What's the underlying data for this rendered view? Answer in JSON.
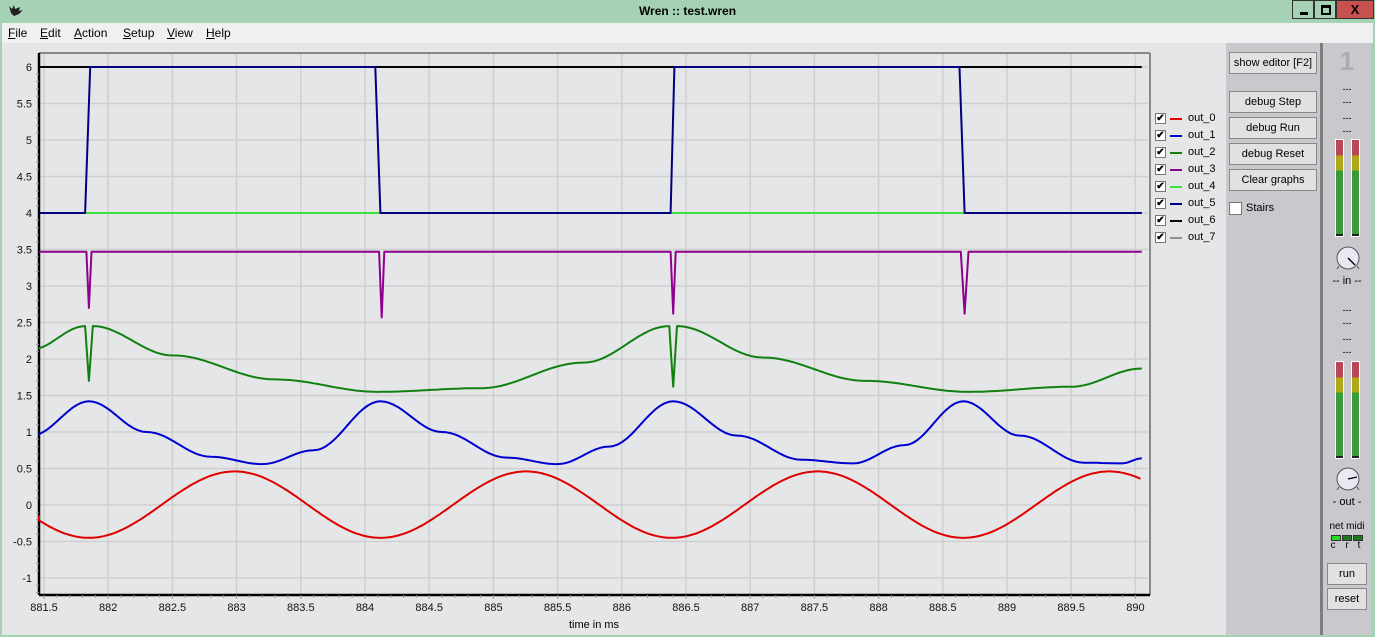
{
  "window": {
    "title": "Wren  ::  test.wren",
    "app_icon": "wren-bird-icon",
    "controls": {
      "minimize": "minimize-icon",
      "maximize": "maximize-icon",
      "close_label": "X"
    }
  },
  "menubar": {
    "items": [
      {
        "label": "File",
        "mnemonic": "F",
        "rest": "ile"
      },
      {
        "label": "Edit",
        "mnemonic": "E",
        "rest": "dit"
      },
      {
        "label": "Action",
        "mnemonic": "A",
        "rest": "ction"
      },
      {
        "label": "Setup",
        "mnemonic": "S",
        "rest": "etup"
      },
      {
        "label": "View",
        "mnemonic": "V",
        "rest": "iew"
      },
      {
        "label": "Help",
        "mnemonic": "H",
        "rest": "elp"
      }
    ]
  },
  "side_panel": {
    "show_editor": "show editor [F2]",
    "debug_step": "debug Step",
    "debug_run": "debug Run",
    "debug_reset": "debug Reset",
    "clear_graphs": "Clear graphs",
    "stairs_label": "Stairs",
    "stairs_checked": false
  },
  "mixer": {
    "channel_number": "1",
    "dash": "---",
    "in_label": "-- in --",
    "out_label": "- out -",
    "net_midi_label": "net midi",
    "led_labels": [
      "c",
      "r",
      "t"
    ],
    "led_states": [
      "on",
      "off",
      "off"
    ],
    "run_label": "run",
    "reset_label": "reset",
    "colors": {
      "meter_red": "#b84858",
      "meter_yellow": "#b0a818",
      "meter_green": "#3a9a3a",
      "led_on": "#22e022",
      "led_off": "#1c7a1c"
    }
  },
  "chart_data": {
    "type": "line",
    "title": "",
    "xlabel": "time in ms",
    "ylabel": "",
    "xlim": [
      881.4,
      890.05
    ],
    "ylim": [
      -1.25,
      6.2
    ],
    "grid": true,
    "legend_position": "right",
    "x_ticks": [
      "881.5",
      "882",
      "882.5",
      "883",
      "883.5",
      "884",
      "884.5",
      "885",
      "885.5",
      "886",
      "886.5",
      "887",
      "887.5",
      "888",
      "888.5",
      "889",
      "889.5",
      "890"
    ],
    "y_ticks": [
      "6",
      "5.5",
      "5",
      "4.5",
      "4",
      "3.5",
      "3",
      "2.5",
      "2",
      "1.5",
      "1",
      "0.5",
      "0",
      "-0.5",
      "-1"
    ],
    "series": [
      {
        "name": "out_0",
        "color": "#e00000",
        "checked": true,
        "x": [
          881.4,
          881.85,
          882.42,
          883.0,
          883.57,
          884.13,
          884.7,
          885.27,
          885.84,
          886.41,
          886.98,
          887.55,
          888.12,
          888.68,
          889.25,
          889.82,
          890.05
        ],
        "y": [
          -0.15,
          -0.45,
          0.0,
          0.46,
          0.0,
          -0.45,
          0.0,
          0.46,
          0.0,
          -0.45,
          0.0,
          0.46,
          0.0,
          -0.45,
          0.0,
          0.46,
          0.38
        ]
      },
      {
        "name": "out_1",
        "color": "#0000d0",
        "checked": true,
        "x": [
          881.4,
          881.85,
          882.3,
          882.8,
          883.2,
          883.6,
          884.12,
          884.6,
          885.1,
          885.5,
          885.9,
          886.4,
          886.9,
          887.4,
          887.8,
          888.2,
          888.66,
          889.1,
          889.6,
          889.9,
          890.05
        ],
        "y": [
          0.95,
          1.42,
          1.0,
          0.66,
          0.56,
          0.75,
          1.42,
          1.0,
          0.65,
          0.56,
          0.8,
          1.42,
          0.95,
          0.62,
          0.57,
          0.82,
          1.42,
          0.95,
          0.58,
          0.57,
          0.64
        ]
      },
      {
        "name": "out_2",
        "color": "#108010",
        "checked": true,
        "x": [
          881.4,
          881.82,
          881.85,
          881.88,
          882.5,
          883.3,
          884.1,
          884.9,
          885.7,
          886.37,
          886.4,
          886.43,
          887.1,
          887.9,
          888.7,
          889.5,
          890.05
        ],
        "y": [
          2.13,
          2.45,
          1.7,
          2.45,
          2.05,
          1.72,
          1.55,
          1.6,
          1.95,
          2.45,
          1.62,
          2.45,
          2.02,
          1.7,
          1.55,
          1.62,
          1.87
        ]
      },
      {
        "name": "out_3",
        "color": "#900090",
        "checked": true,
        "x": [
          881.4,
          881.83,
          881.85,
          881.87,
          884.11,
          884.13,
          884.15,
          886.38,
          886.4,
          886.42,
          888.64,
          888.67,
          888.7,
          890.05
        ],
        "y": [
          3.47,
          3.47,
          2.7,
          3.47,
          3.47,
          2.57,
          3.47,
          3.47,
          2.62,
          3.47,
          3.47,
          2.62,
          3.47,
          3.47
        ]
      },
      {
        "name": "out_4",
        "color": "#40e040",
        "checked": true,
        "x": [
          881.4,
          890.05
        ],
        "y": [
          4.0,
          4.0
        ]
      },
      {
        "name": "out_5",
        "color": "#000080",
        "checked": true,
        "x": [
          881.4,
          881.82,
          881.86,
          884.08,
          884.12,
          886.38,
          886.41,
          888.63,
          888.67,
          890.05
        ],
        "y": [
          4.0,
          4.0,
          6.0,
          6.0,
          4.0,
          4.0,
          6.0,
          6.0,
          4.0,
          4.0
        ]
      },
      {
        "name": "out_6",
        "color": "#000000",
        "checked": true,
        "x": [
          881.4,
          890.05
        ],
        "y": [
          6.0,
          6.0
        ]
      },
      {
        "name": "out_7",
        "color": "#909090",
        "checked": true,
        "x": [],
        "y": []
      }
    ]
  }
}
